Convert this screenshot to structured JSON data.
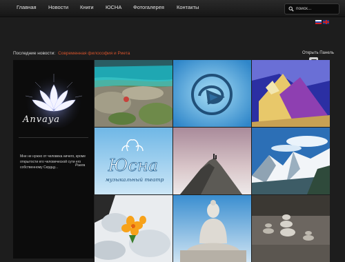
{
  "nav": {
    "items": [
      "Главная",
      "Новости",
      "Книги",
      "ЮСНА",
      "Фотогалерея",
      "Контакты"
    ]
  },
  "search": {
    "placeholder": "поиск..."
  },
  "news": {
    "label": "Последние новости:",
    "link": "Современная философия и Риета"
  },
  "panel": {
    "toggle_label": "Открыть Панель"
  },
  "sidebar": {
    "logo_word": "Anvaya",
    "quote": "Мне не нужно от человека ничего, кроме открытости его человеческой сути его собственному Сердцу...",
    "author": "Риела"
  },
  "gallery": {
    "tiles": [
      {
        "name": "lake-tile"
      },
      {
        "name": "emblem-tile"
      },
      {
        "name": "painting-tile"
      },
      {
        "name": "yusna-theatre-tile",
        "title": "Юсна",
        "subtitle": "музыкальный театр"
      },
      {
        "name": "summit-tile"
      },
      {
        "name": "mountains-tile"
      },
      {
        "name": "flower-tile"
      },
      {
        "name": "buddha-tile"
      },
      {
        "name": "stones-tile"
      }
    ]
  },
  "colors": {
    "accent": "#d8542c",
    "background": "#1d1d1d",
    "sidebar": "#0c0c0c"
  }
}
